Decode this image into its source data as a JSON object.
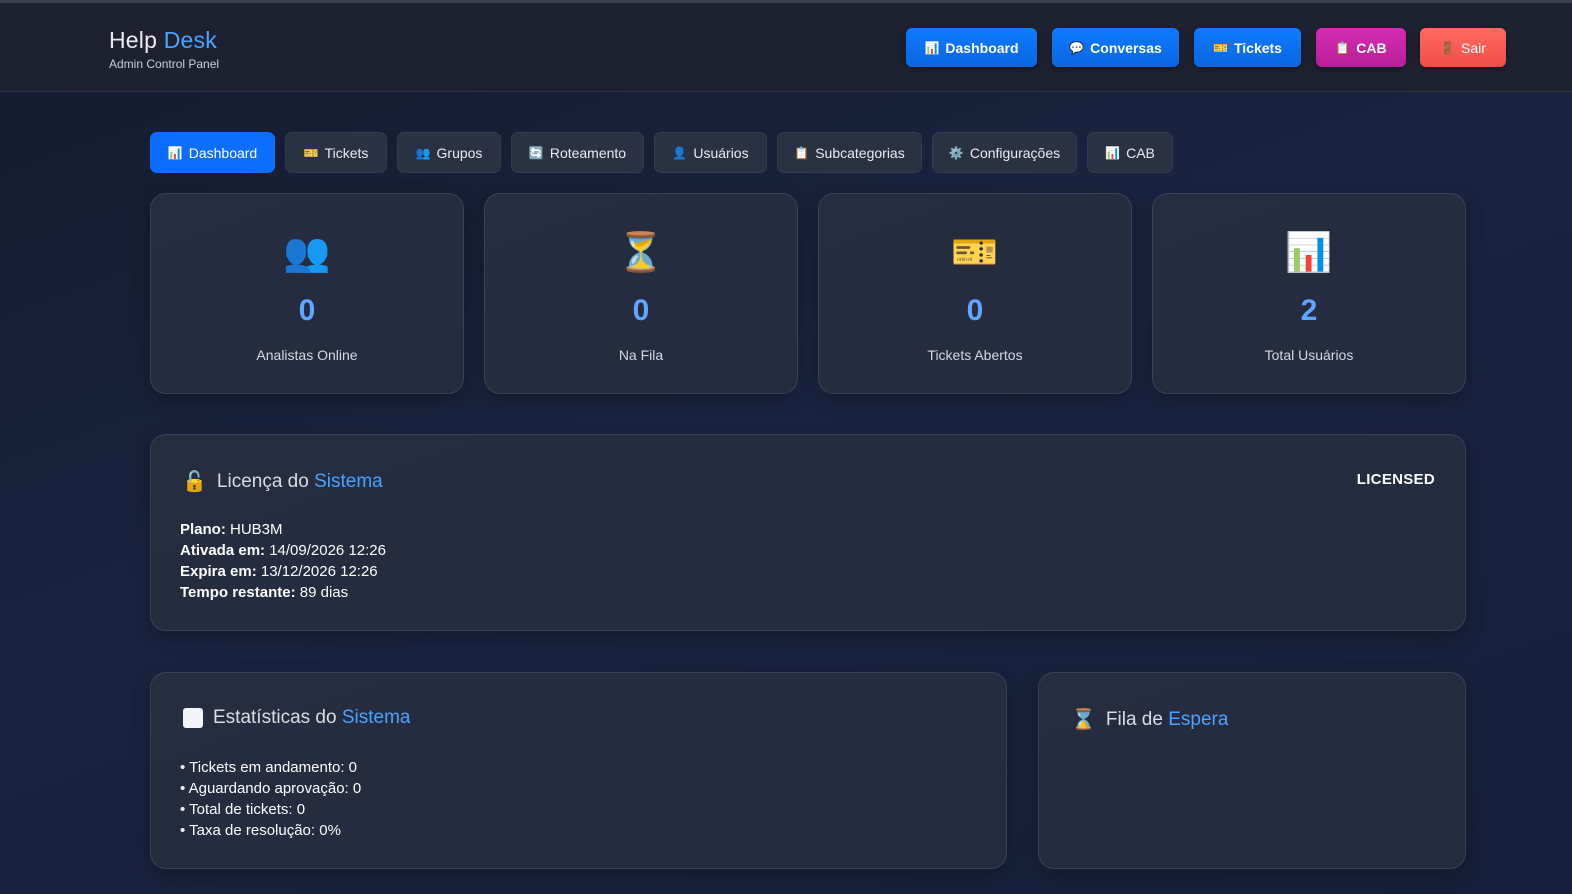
{
  "app": {
    "title_main": "Help",
    "title_accent": "Desk",
    "subtitle": "Admin Control Panel"
  },
  "topnav": [
    {
      "icon": "📊",
      "label": "Dashboard",
      "color": "#0d7bff"
    },
    {
      "icon": "💬",
      "label": "Conversas",
      "color": "#0d7bff"
    },
    {
      "icon": "🎫",
      "label": "Tickets",
      "color": "#0d7bff"
    },
    {
      "icon": "📋",
      "label": "CAB",
      "color": "#d62bb5"
    },
    {
      "icon": "🚪",
      "label": "Sair",
      "color": "#ff6a63"
    }
  ],
  "tabs": [
    {
      "icon": "📊",
      "label": "Dashboard",
      "active": true
    },
    {
      "icon": "🎫",
      "label": "Tickets"
    },
    {
      "icon": "👥",
      "label": "Grupos"
    },
    {
      "icon": "🔄",
      "label": "Roteamento"
    },
    {
      "icon": "👤",
      "label": "Usuários"
    },
    {
      "icon": "📋",
      "label": "Subcategorias"
    },
    {
      "icon": "⚙️",
      "label": "Configurações"
    },
    {
      "icon": "📊",
      "label": "CAB"
    }
  ],
  "stats": [
    {
      "icon": "👥",
      "icon_name": "users-icon",
      "value": "0",
      "label": "Analistas Online"
    },
    {
      "icon": "⏳",
      "icon_name": "hourglass-icon",
      "value": "0",
      "label": "Na Fila"
    },
    {
      "icon": "🎫",
      "icon_name": "ticket-icon",
      "value": "0",
      "label": "Tickets Abertos"
    },
    {
      "icon": "📊",
      "icon_name": "bar-chart-icon",
      "value": "2",
      "label": "Total Usuários"
    }
  ],
  "license": {
    "icon": "🔓",
    "title_main": "Licença do",
    "title_accent": "Sistema",
    "status": "LICENSED",
    "plan_label": "Plano:",
    "plan_value": "HUB3M",
    "activated_label": "Ativada em:",
    "activated_value": "14/09/2026 12:26",
    "expires_label": "Expira em:",
    "expires_value": "13/12/2026 12:26",
    "remaining_label": "Tempo restante:",
    "remaining_value": "89 dias"
  },
  "system_stats": {
    "title_main": "Estatísticas do",
    "title_accent": "Sistema",
    "lines": [
      "• Tickets em andamento: 0",
      "• Aguardando aprovação: 0",
      "• Total de tickets: 0",
      "• Taxa de resolução: 0%"
    ]
  },
  "queue": {
    "icon": "⌛",
    "title_main": "Fila de",
    "title_accent": "Espera"
  },
  "colors": {
    "accent": "#4aa3ff",
    "primary_button": "#0d6efd",
    "stat_value": "#5ea6ff"
  }
}
